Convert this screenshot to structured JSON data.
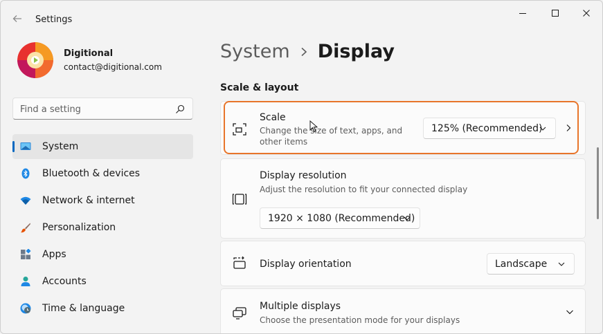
{
  "window": {
    "title": "Settings"
  },
  "profile": {
    "name": "Digitional",
    "email": "contact@digitional.com"
  },
  "search": {
    "placeholder": "Find a setting"
  },
  "nav": {
    "items": [
      {
        "label": "System",
        "icon": "monitor-icon",
        "selected": true
      },
      {
        "label": "Bluetooth & devices",
        "icon": "bluetooth-icon"
      },
      {
        "label": "Network & internet",
        "icon": "wifi-icon"
      },
      {
        "label": "Personalization",
        "icon": "brush-icon"
      },
      {
        "label": "Apps",
        "icon": "apps-icon"
      },
      {
        "label": "Accounts",
        "icon": "person-icon"
      },
      {
        "label": "Time & language",
        "icon": "globe-clock-icon"
      }
    ]
  },
  "main": {
    "breadcrumb": {
      "parent": "System",
      "current": "Display"
    },
    "section_title": "Scale & layout",
    "scale": {
      "title": "Scale",
      "description": "Change the size of text, apps, and other items",
      "value": "125% (Recommended)"
    },
    "resolution": {
      "title": "Display resolution",
      "description": "Adjust the resolution to fit your connected display",
      "value": "1920 × 1080 (Recommended)"
    },
    "orientation": {
      "title": "Display orientation",
      "value": "Landscape"
    },
    "multiple": {
      "title": "Multiple displays",
      "description": "Choose the presentation mode for your displays"
    }
  },
  "colors": {
    "accent": "#0067c0",
    "highlight": "#e8752a"
  }
}
